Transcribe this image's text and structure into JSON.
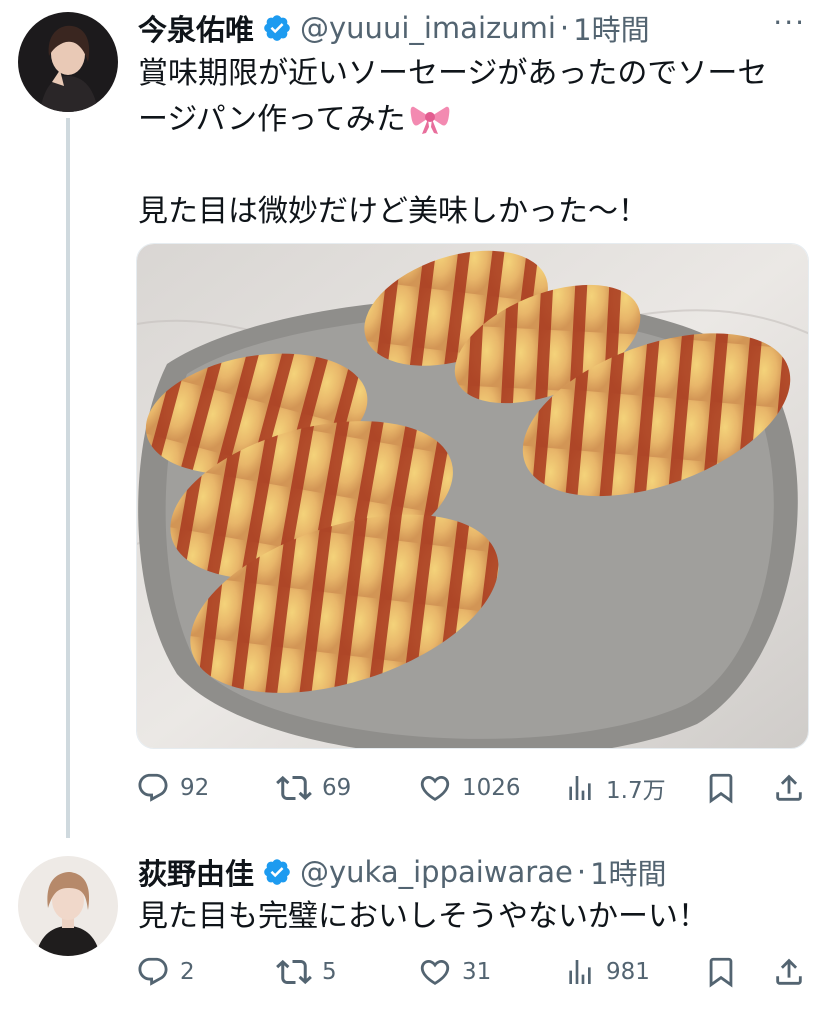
{
  "tweet1": {
    "name": "今泉佑唯",
    "handle": "@yuuui_imaizumi",
    "dot": "·",
    "time": "1時間",
    "more": "···",
    "text_line1": "賞味期限が近いソーセージがあったのでソーセ",
    "text_line2": "ージパン作ってみた",
    "text_line3": "見た目は微妙だけど美味しかった〜！",
    "replies": "92",
    "retweets": "69",
    "likes": "1026",
    "views": "1.7万"
  },
  "tweet2": {
    "name": "荻野由佳",
    "handle": "@yuka_ippaiwarae",
    "dot": "·",
    "time": "1時間",
    "text": "見た目も完璧においしそうやないかーい！",
    "replies": "2",
    "retweets": "5",
    "likes": "31",
    "views": "981"
  },
  "colors": {
    "verified": "#1d9bf0",
    "muted": "#536471",
    "thread_line": "#cfd9de"
  },
  "icons": [
    "verified-badge-icon",
    "reply-icon",
    "retweet-icon",
    "like-icon",
    "views-icon",
    "bookmark-icon",
    "share-icon",
    "more-icon",
    "ribbon-emoji"
  ]
}
